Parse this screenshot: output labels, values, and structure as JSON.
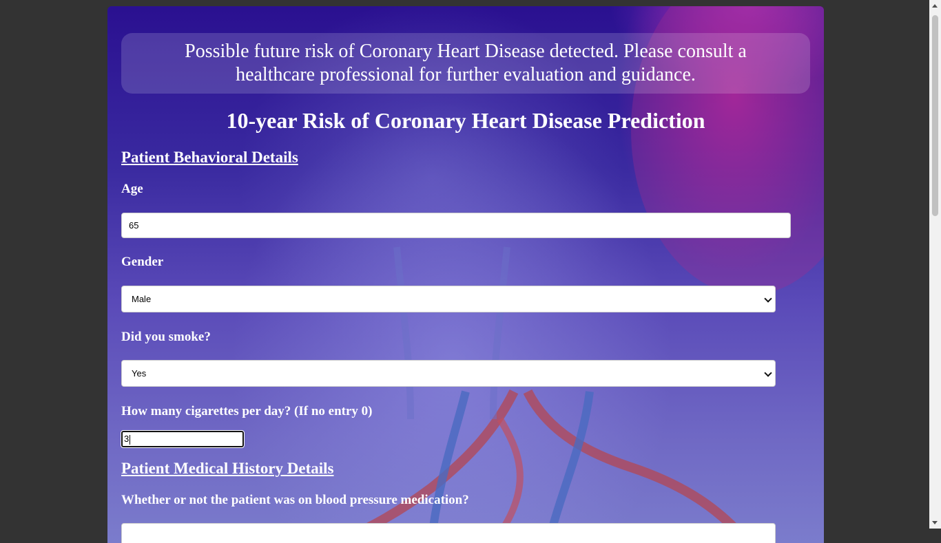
{
  "alert": {
    "message": "Possible future risk of Coronary Heart Disease detected. Please consult a healthcare professional for further evaluation and guidance."
  },
  "page_title": "10-year Risk of Coronary Heart Disease Prediction",
  "behavioral": {
    "section_title": "Patient Behavioral Details",
    "age_label": "Age",
    "age_value": "65",
    "gender_label": "Gender",
    "gender_value": "Male",
    "smoke_label": "Did you smoke?",
    "smoke_value": "Yes",
    "cigs_label": "How many cigarettes per day? (If no entry 0)",
    "cigs_value": "3"
  },
  "medical": {
    "section_title": "Patient Medical History Details",
    "bp_meds_label": "Whether or not the patient was on blood pressure medication?"
  },
  "colors": {
    "page_background": "#333333",
    "card_gradient_top": "#2a1090",
    "card_gradient_bottom": "#7b7ccc",
    "text": "#ffffff"
  }
}
